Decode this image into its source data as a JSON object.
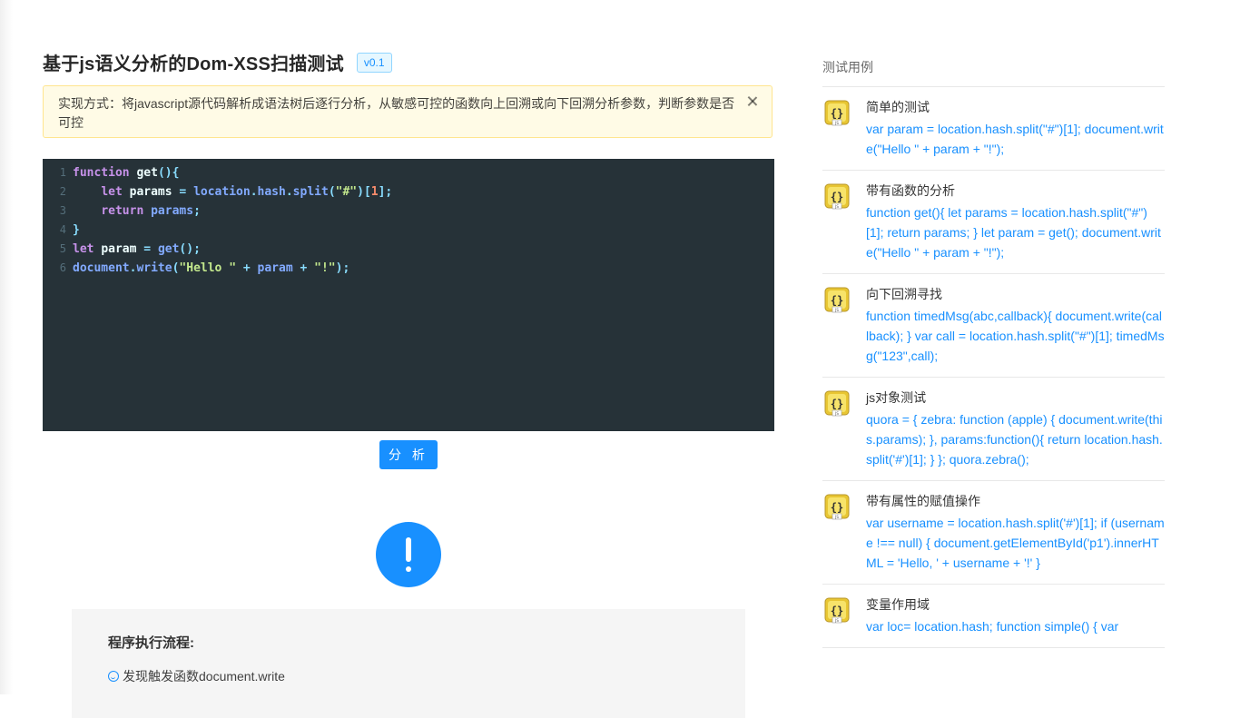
{
  "header": {
    "title": "基于js语义分析的Dom-XSS扫描测试",
    "version": "v0.1"
  },
  "alert": {
    "text": "实现方式：将javascript源代码解析成语法树后逐行分析，从敏感可控的函数向上回溯或向下回溯分析参数，判断参数是否可控"
  },
  "editor": {
    "line_numbers": [
      "1",
      "2",
      "3",
      "4",
      "5",
      "6"
    ]
  },
  "actions": {
    "analyze_label": "分 析"
  },
  "result": {
    "flow_title": "程序执行流程:",
    "steps": [
      "发现触发函数document.write"
    ]
  },
  "sidebar": {
    "heading": "测试用例",
    "cases": [
      {
        "title": "简单的测试",
        "code": "var param = location.hash.split(\"#\")[1]; document.write(\"Hello \" + param + \"!\");"
      },
      {
        "title": "带有函数的分析",
        "code": "function get(){ let params = location.hash.split(\"#\")[1]; return params; } let param = get(); document.write(\"Hello \" + param + \"!\");"
      },
      {
        "title": "向下回溯寻找",
        "code": "function timedMsg(abc,callback){ document.write(callback); } var call = location.hash.split(\"#\")[1]; timedMsg(\"123\",call);"
      },
      {
        "title": "js对象测试",
        "code": "quora = { zebra: function (apple) { document.write(this.params); }, params:function(){ return location.hash.split('#')[1]; } }; quora.zebra();"
      },
      {
        "title": "带有属性的赋值操作",
        "code": "var username = location.hash.split('#')[1]; if (username !== null) { document.getElementById('p1').innerHTML = 'Hello, ' + username + '!' }"
      },
      {
        "title": "变量作用域",
        "code": "var loc= location.hash; function simple() { var"
      }
    ]
  },
  "icons": {
    "case_icon": "js-file-icon",
    "alert_close": "close-icon",
    "result_status": "exclamation-icon",
    "step_icon": "smile-icon"
  },
  "colors": {
    "primary": "#1890ff",
    "editor_bg": "#263238",
    "alert_bg": "#fffbe6"
  }
}
